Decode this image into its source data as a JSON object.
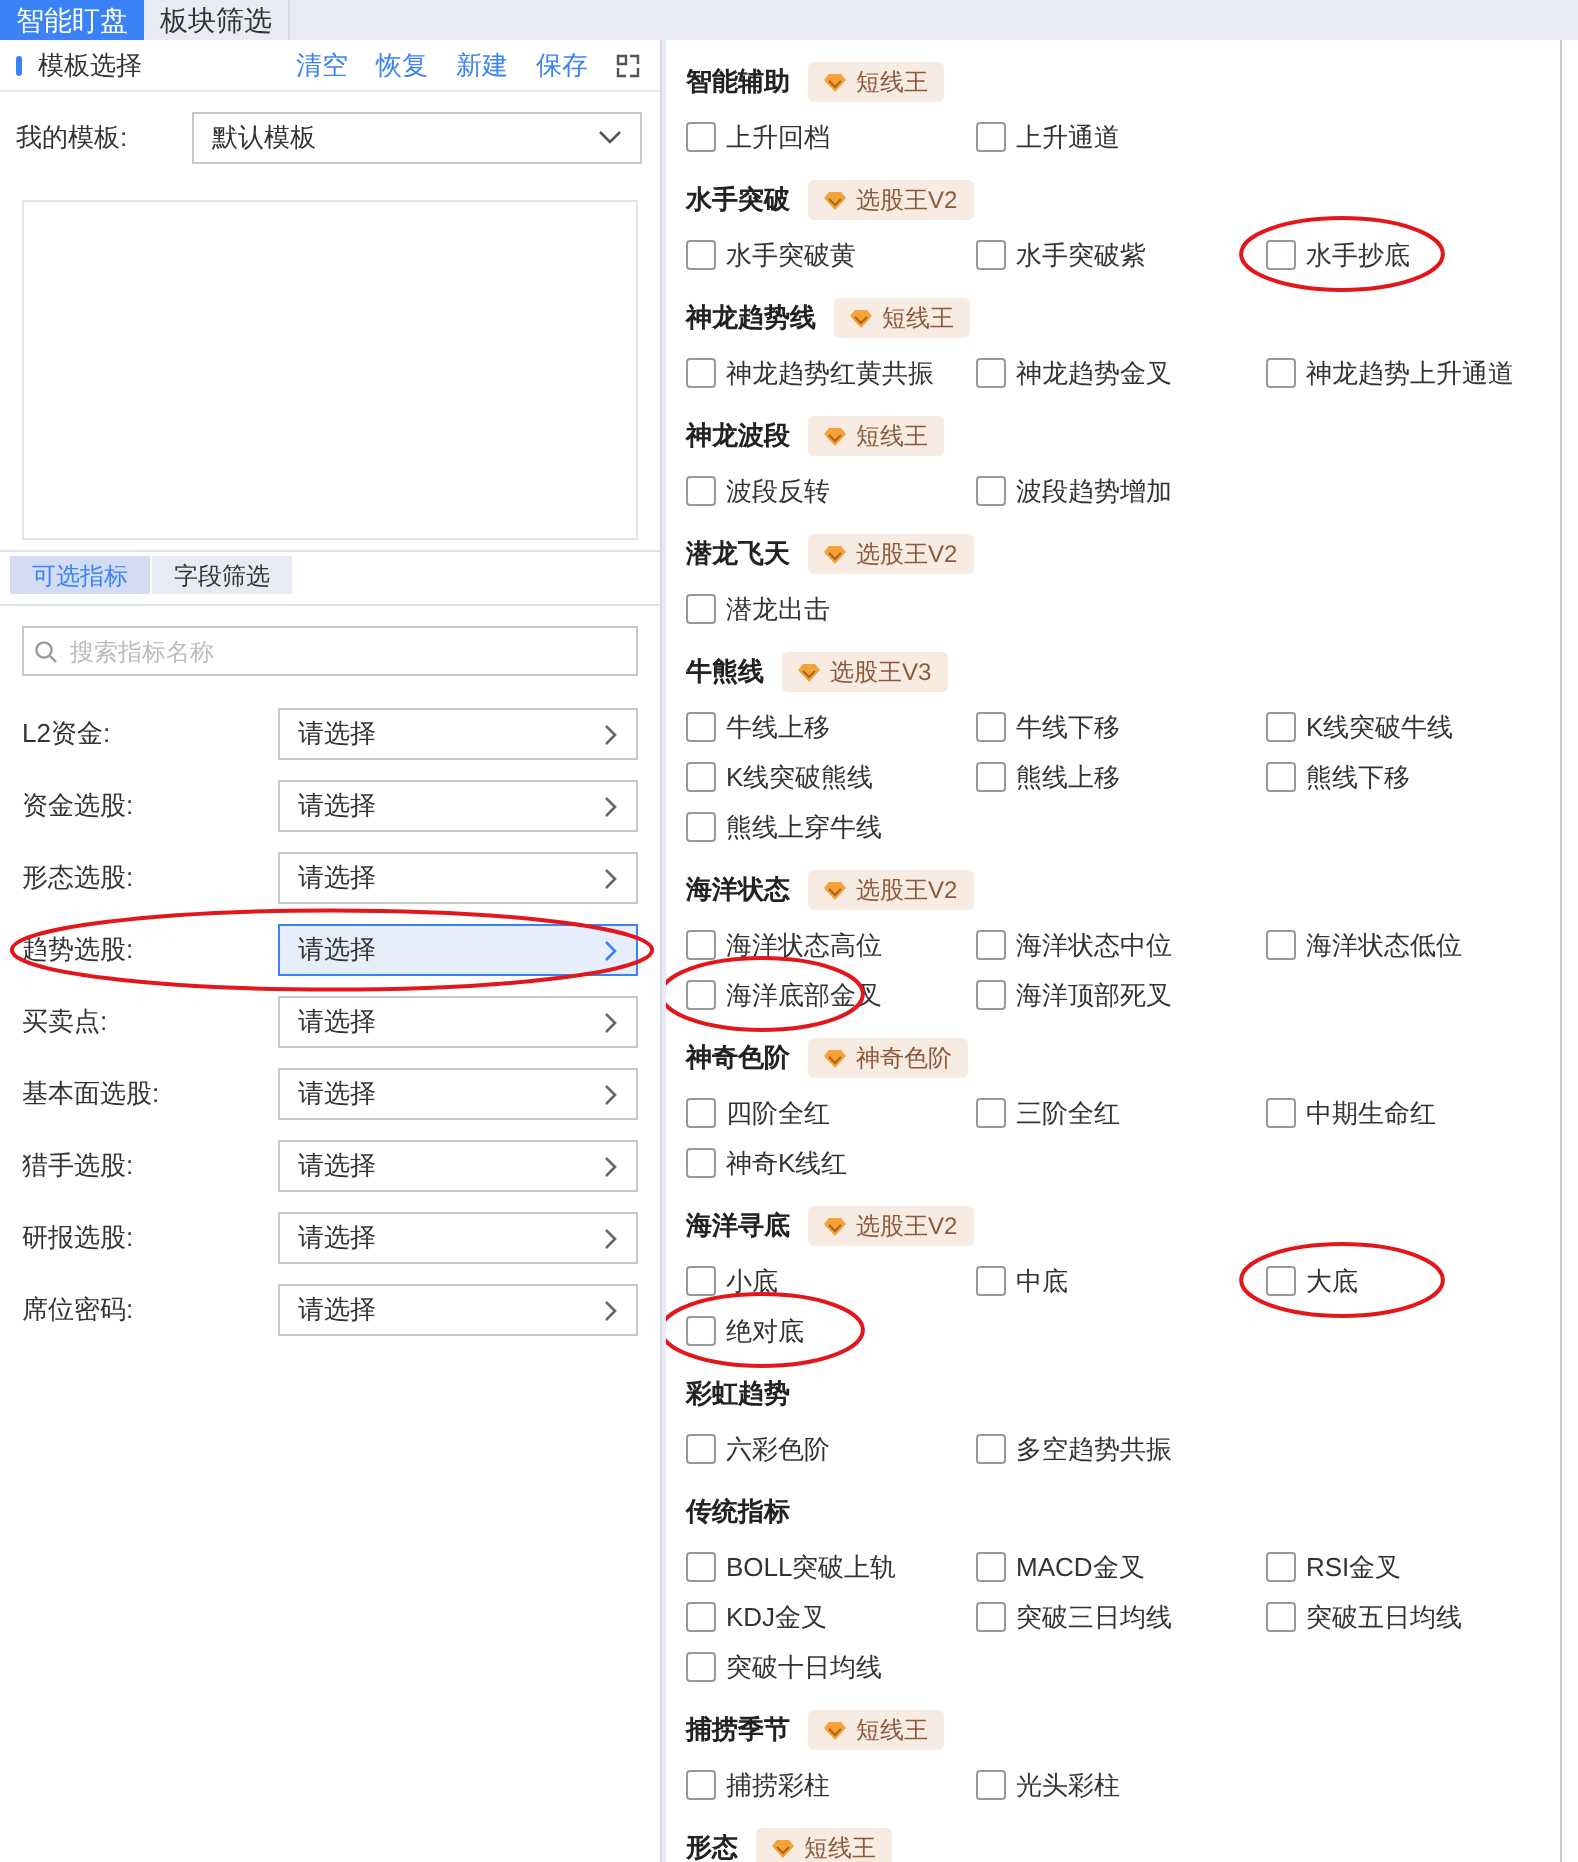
{
  "top_tabs": [
    {
      "label": "智能盯盘",
      "selected": true
    },
    {
      "label": "板块筛选",
      "selected": false
    }
  ],
  "template_panel": {
    "title": "模板选择",
    "actions": [
      "清空",
      "恢复",
      "新建",
      "保存"
    ],
    "my_template_label": "我的模板:",
    "my_template_value": "默认模板"
  },
  "sub_tabs": [
    {
      "label": "可选指标",
      "selected": true
    },
    {
      "label": "字段筛选",
      "selected": false
    }
  ],
  "search": {
    "placeholder": "搜索指标名称"
  },
  "filters": [
    {
      "label": "L2资金:",
      "value": "请选择",
      "selected": false,
      "circled": false
    },
    {
      "label": "资金选股:",
      "value": "请选择",
      "selected": false,
      "circled": false
    },
    {
      "label": "形态选股:",
      "value": "请选择",
      "selected": false,
      "circled": false
    },
    {
      "label": "趋势选股:",
      "value": "请选择",
      "selected": true,
      "circled": true
    },
    {
      "label": "买卖点:",
      "value": "请选择",
      "selected": false,
      "circled": false
    },
    {
      "label": "基本面选股:",
      "value": "请选择",
      "selected": false,
      "circled": false
    },
    {
      "label": "猎手选股:",
      "value": "请选择",
      "selected": false,
      "circled": false
    },
    {
      "label": "研报选股:",
      "value": "请选择",
      "selected": false,
      "circled": false
    },
    {
      "label": "席位密码:",
      "value": "请选择",
      "selected": false,
      "circled": false
    }
  ],
  "sections": [
    {
      "title": "智能辅助",
      "badge": "短线王",
      "items": [
        {
          "label": "上升回档",
          "checked": false,
          "circled": false
        },
        {
          "label": "上升通道",
          "checked": false,
          "circled": false
        }
      ]
    },
    {
      "title": "水手突破",
      "badge": "选股王V2",
      "items": [
        {
          "label": "水手突破黄",
          "checked": false,
          "circled": false
        },
        {
          "label": "水手突破紫",
          "checked": false,
          "circled": false
        },
        {
          "label": "水手抄底",
          "checked": false,
          "circled": true
        }
      ]
    },
    {
      "title": "神龙趋势线",
      "badge": "短线王",
      "items": [
        {
          "label": "神龙趋势红黄共振",
          "checked": false,
          "circled": false
        },
        {
          "label": "神龙趋势金叉",
          "checked": false,
          "circled": false
        },
        {
          "label": "神龙趋势上升通道",
          "checked": false,
          "circled": false
        }
      ]
    },
    {
      "title": "神龙波段",
      "badge": "短线王",
      "items": [
        {
          "label": "波段反转",
          "checked": false,
          "circled": false
        },
        {
          "label": "波段趋势增加",
          "checked": false,
          "circled": false
        }
      ]
    },
    {
      "title": "潜龙飞天",
      "badge": "选股王V2",
      "items": [
        {
          "label": "潜龙出击",
          "checked": false,
          "circled": false
        }
      ]
    },
    {
      "title": "牛熊线",
      "badge": "选股王V3",
      "items": [
        {
          "label": "牛线上移",
          "checked": false,
          "circled": false
        },
        {
          "label": "牛线下移",
          "checked": false,
          "circled": false
        },
        {
          "label": "K线突破牛线",
          "checked": false,
          "circled": false
        },
        {
          "label": "K线突破熊线",
          "checked": false,
          "circled": false
        },
        {
          "label": "熊线上移",
          "checked": false,
          "circled": false
        },
        {
          "label": "熊线下移",
          "checked": false,
          "circled": false
        },
        {
          "label": "熊线上穿牛线",
          "checked": false,
          "circled": false
        }
      ]
    },
    {
      "title": "海洋状态",
      "badge": "选股王V2",
      "items": [
        {
          "label": "海洋状态高位",
          "checked": false,
          "circled": false
        },
        {
          "label": "海洋状态中位",
          "checked": false,
          "circled": false
        },
        {
          "label": "海洋状态低位",
          "checked": false,
          "circled": false
        },
        {
          "label": "海洋底部金叉",
          "checked": false,
          "circled": true
        },
        {
          "label": "海洋顶部死叉",
          "checked": false,
          "circled": false
        }
      ]
    },
    {
      "title": "神奇色阶",
      "badge": "神奇色阶",
      "items": [
        {
          "label": "四阶全红",
          "checked": false,
          "circled": false
        },
        {
          "label": "三阶全红",
          "checked": false,
          "circled": false
        },
        {
          "label": "中期生命红",
          "checked": false,
          "circled": false
        },
        {
          "label": "神奇K线红",
          "checked": false,
          "circled": false
        }
      ]
    },
    {
      "title": "海洋寻底",
      "badge": "选股王V2",
      "items": [
        {
          "label": "小底",
          "checked": false,
          "circled": false
        },
        {
          "label": "中底",
          "checked": false,
          "circled": false
        },
        {
          "label": "大底",
          "checked": false,
          "circled": true
        },
        {
          "label": "绝对底",
          "checked": false,
          "circled": true
        }
      ]
    },
    {
      "title": "彩虹趋势",
      "items": [
        {
          "label": "六彩色阶",
          "checked": false,
          "circled": false
        },
        {
          "label": "多空趋势共振",
          "checked": false,
          "circled": false
        }
      ]
    },
    {
      "title": "传统指标",
      "items": [
        {
          "label": "BOLL突破上轨",
          "checked": false,
          "circled": false
        },
        {
          "label": "MACD金叉",
          "checked": false,
          "circled": false
        },
        {
          "label": "RSI金叉",
          "checked": false,
          "circled": false
        },
        {
          "label": "KDJ金叉",
          "checked": false,
          "circled": false
        },
        {
          "label": "突破三日均线",
          "checked": false,
          "circled": false
        },
        {
          "label": "突破五日均线",
          "checked": false,
          "circled": false
        },
        {
          "label": "突破十日均线",
          "checked": false,
          "circled": false
        }
      ]
    },
    {
      "title": "捕捞季节",
      "badge": "短线王",
      "items": [
        {
          "label": "捕捞彩柱",
          "checked": false,
          "circled": false
        },
        {
          "label": "光头彩柱",
          "checked": false,
          "circled": false
        }
      ]
    },
    {
      "title": "形态",
      "badge": "短线王"
    }
  ]
}
